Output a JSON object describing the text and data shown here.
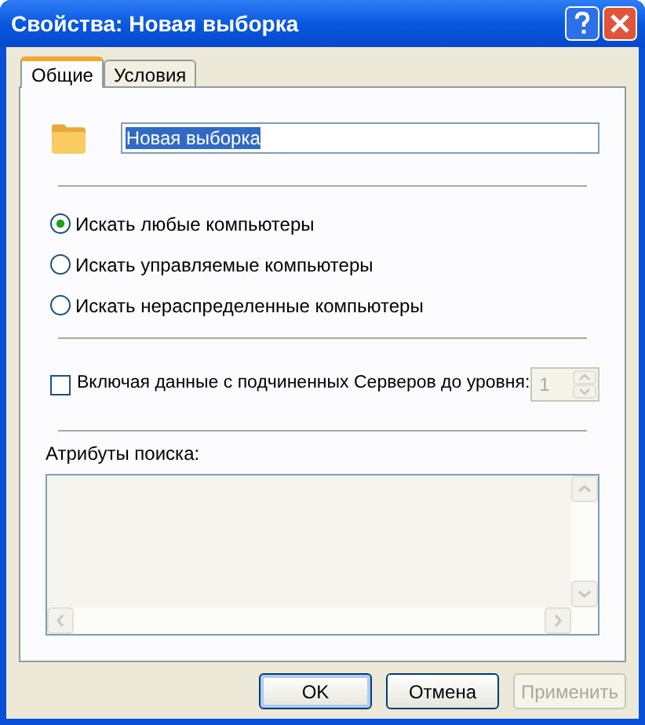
{
  "window": {
    "title": "Свойства: Новая выборка"
  },
  "tabs": [
    {
      "label": "Общие",
      "selected": true
    },
    {
      "label": "Условия",
      "selected": false
    }
  ],
  "name_field": {
    "value": "Новая выборка",
    "text_selected": true
  },
  "search_scope": [
    {
      "label": "Искать любые компьютеры",
      "selected": true
    },
    {
      "label": "Искать управляемые компьютеры",
      "selected": false
    },
    {
      "label": "Искать нераспределенные компьютеры",
      "selected": false
    }
  ],
  "include_subordinate": {
    "label": "Включая данные с подчиненных Серверов до уровня:",
    "checked": false
  },
  "level_spinner": {
    "value": "1",
    "disabled": true
  },
  "search_attributes": {
    "label": "Атрибуты поиска:",
    "disabled": true
  },
  "buttons": [
    {
      "label": "OK",
      "default": true,
      "disabled": false
    },
    {
      "label": "Отмена",
      "default": false,
      "disabled": false
    },
    {
      "label": "Применить",
      "default": false,
      "disabled": true
    }
  ]
}
